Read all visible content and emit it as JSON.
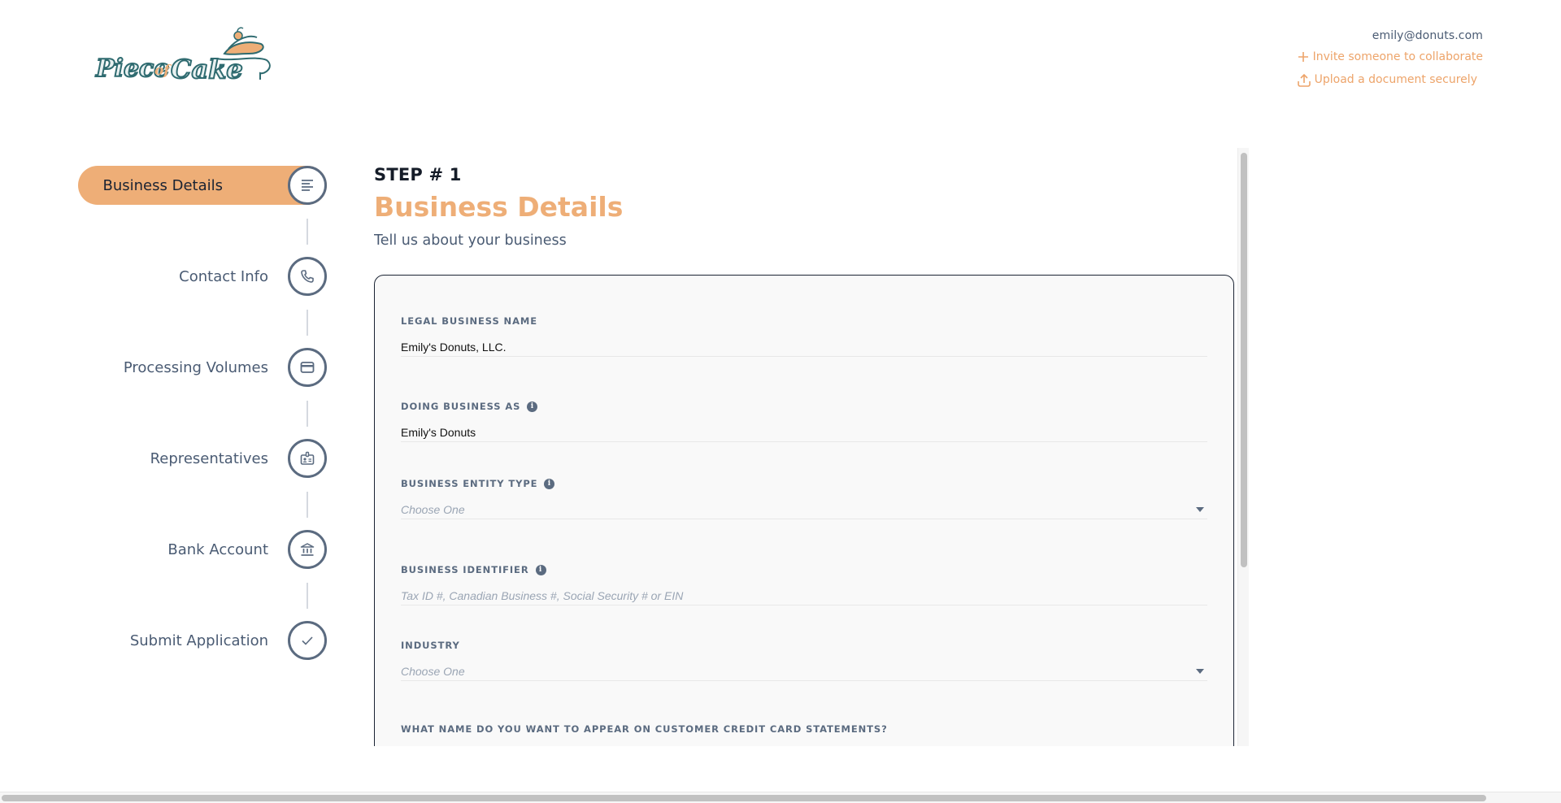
{
  "brand": {
    "logo_text_1": "Piece",
    "logo_text_2": "of",
    "logo_text_3": "Cake",
    "logo_icon": "cake-slice-icon",
    "colors": {
      "accent": "#eeae77",
      "teal": "#2f6b70",
      "text": "#1a2333",
      "muted": "#4a5b73"
    }
  },
  "header": {
    "user_email": "emily@donuts.com",
    "invite_label": "Invite someone to collaborate",
    "invite_icon": "plus-icon",
    "upload_label": "Upload a document securely",
    "upload_icon": "upload-icon"
  },
  "steps": [
    {
      "label": "Business Details",
      "icon": "text-align-left-icon",
      "active": true
    },
    {
      "label": "Contact Info",
      "icon": "phone-icon",
      "active": false
    },
    {
      "label": "Processing Volumes",
      "icon": "credit-card-icon",
      "active": false
    },
    {
      "label": "Representatives",
      "icon": "id-badge-icon",
      "active": false
    },
    {
      "label": "Bank Account",
      "icon": "bank-icon",
      "active": false
    },
    {
      "label": "Submit Application",
      "icon": "checkmark-icon",
      "active": false
    }
  ],
  "main": {
    "step_number": "STEP # 1",
    "title": "Business Details",
    "subtitle": "Tell us about your business",
    "fields": [
      {
        "label": "LEGAL BUSINESS NAME",
        "value": "Emily's Donuts, LLC.",
        "placeholder": "",
        "info": false,
        "type": "text"
      },
      {
        "label": "DOING BUSINESS AS",
        "value": "Emily's Donuts",
        "placeholder": "",
        "info": true,
        "type": "text"
      },
      {
        "label": "BUSINESS ENTITY TYPE",
        "value": "",
        "placeholder": "Choose One",
        "info": true,
        "type": "select"
      },
      {
        "label": "BUSINESS IDENTIFIER",
        "value": "",
        "placeholder": "Tax ID #, Canadian Business #, Social Security # or EIN",
        "info": true,
        "type": "text"
      },
      {
        "label": "INDUSTRY",
        "value": "",
        "placeholder": "Choose One",
        "info": false,
        "type": "select"
      },
      {
        "label": "WHAT NAME DO YOU WANT TO APPEAR ON CUSTOMER CREDIT CARD STATEMENTS?",
        "value": "",
        "placeholder": "",
        "info": false,
        "type": "text"
      }
    ],
    "info_glyph": "i"
  }
}
